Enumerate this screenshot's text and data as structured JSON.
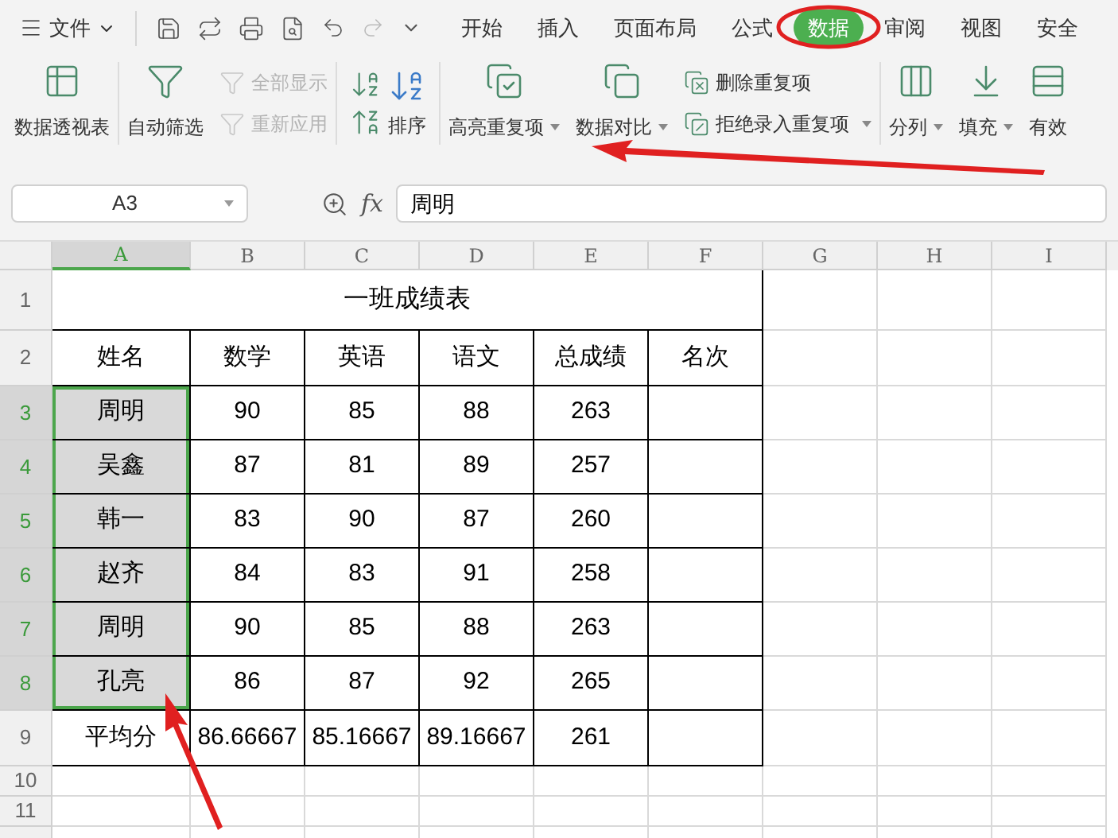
{
  "menu": {
    "file_label": "文件",
    "tabs": [
      {
        "label": "开始",
        "selected": false
      },
      {
        "label": "插入",
        "selected": false
      },
      {
        "label": "页面布局",
        "selected": false
      },
      {
        "label": "公式",
        "selected": false
      },
      {
        "label": "数据",
        "selected": true
      },
      {
        "label": "审阅",
        "selected": false
      },
      {
        "label": "视图",
        "selected": false
      },
      {
        "label": "安全",
        "selected": false
      }
    ]
  },
  "ribbon": [
    {
      "kind": "large",
      "label": "数据透视表",
      "disabled": false,
      "dropdown": false
    },
    {
      "kind": "large",
      "label": "自动筛选",
      "disabled": false,
      "dropdown": false
    },
    {
      "kind": "stack",
      "items": [
        {
          "label": "全部显示",
          "disabled": true,
          "dropdown": false
        },
        {
          "label": "重新应用",
          "disabled": true,
          "dropdown": false
        }
      ]
    },
    {
      "kind": "sort",
      "label": "排序",
      "disabled": false,
      "dropdown": false
    },
    {
      "kind": "large",
      "label": "高亮重复项",
      "disabled": false,
      "dropdown": true
    },
    {
      "kind": "large",
      "label": "数据对比",
      "disabled": false,
      "dropdown": true
    },
    {
      "kind": "stack",
      "items": [
        {
          "label": "删除重复项",
          "disabled": false,
          "dropdown": false
        },
        {
          "label": "拒绝录入重复项",
          "disabled": false,
          "dropdown": true
        }
      ]
    },
    {
      "kind": "large",
      "label": "分列",
      "disabled": false,
      "dropdown": true
    },
    {
      "kind": "large",
      "label": "填充",
      "disabled": false,
      "dropdown": true
    },
    {
      "kind": "large",
      "label": "有效",
      "disabled": false,
      "dropdown": false
    }
  ],
  "formula_bar": {
    "cell_ref": "A3",
    "fx": "fx",
    "value": "周明"
  },
  "sheet": {
    "columns": [
      {
        "label": "A",
        "selected": true
      },
      {
        "label": "B",
        "selected": false
      },
      {
        "label": "C",
        "selected": false
      },
      {
        "label": "D",
        "selected": false
      },
      {
        "label": "E",
        "selected": false
      },
      {
        "label": "F",
        "selected": false
      },
      {
        "label": "G",
        "selected": false
      },
      {
        "label": "H",
        "selected": false
      },
      {
        "label": "I",
        "selected": false
      }
    ],
    "rows": [
      {
        "kind": "title",
        "header": "1",
        "selected": false,
        "title": "一班成绩表"
      },
      {
        "kind": "data",
        "header": "2",
        "selected": false,
        "cells": [
          {
            "text": "姓名",
            "selected": false
          },
          {
            "text": "数学",
            "selected": false
          },
          {
            "text": "英语",
            "selected": false
          },
          {
            "text": "语文",
            "selected": false
          },
          {
            "text": "总成绩",
            "selected": false
          },
          {
            "text": "名次",
            "selected": false
          }
        ]
      },
      {
        "kind": "data",
        "header": "3",
        "selected": true,
        "cells": [
          {
            "text": "周明",
            "selected": true
          },
          {
            "text": "90",
            "selected": false
          },
          {
            "text": "85",
            "selected": false
          },
          {
            "text": "88",
            "selected": false
          },
          {
            "text": "263",
            "selected": false
          },
          {
            "selected": false
          }
        ]
      },
      {
        "kind": "data",
        "header": "4",
        "selected": true,
        "cells": [
          {
            "text": "吴鑫",
            "selected": true
          },
          {
            "text": "87",
            "selected": false
          },
          {
            "text": "81",
            "selected": false
          },
          {
            "text": "89",
            "selected": false
          },
          {
            "text": "257",
            "selected": false
          },
          {
            "selected": false
          }
        ]
      },
      {
        "kind": "data",
        "header": "5",
        "selected": true,
        "cells": [
          {
            "text": "韩一",
            "selected": true
          },
          {
            "text": "83",
            "selected": false
          },
          {
            "text": "90",
            "selected": false
          },
          {
            "text": "87",
            "selected": false
          },
          {
            "text": "260",
            "selected": false
          },
          {
            "selected": false
          }
        ]
      },
      {
        "kind": "data",
        "header": "6",
        "selected": true,
        "cells": [
          {
            "text": "赵齐",
            "selected": true
          },
          {
            "text": "84",
            "selected": false
          },
          {
            "text": "83",
            "selected": false
          },
          {
            "text": "91",
            "selected": false
          },
          {
            "text": "258",
            "selected": false
          },
          {
            "selected": false
          }
        ]
      },
      {
        "kind": "data",
        "header": "7",
        "selected": true,
        "cells": [
          {
            "text": "周明",
            "selected": true
          },
          {
            "text": "90",
            "selected": false
          },
          {
            "text": "85",
            "selected": false
          },
          {
            "text": "88",
            "selected": false
          },
          {
            "text": "263",
            "selected": false
          },
          {
            "selected": false
          }
        ]
      },
      {
        "kind": "data",
        "header": "8",
        "selected": true,
        "cells": [
          {
            "text": "孔亮",
            "selected": true
          },
          {
            "text": "86",
            "selected": false
          },
          {
            "text": "87",
            "selected": false
          },
          {
            "text": "92",
            "selected": false
          },
          {
            "text": "265",
            "selected": false
          },
          {
            "selected": false
          }
        ]
      },
      {
        "kind": "data",
        "header": "9",
        "selected": false,
        "cells": [
          {
            "text": "平均分",
            "selected": false
          },
          {
            "text": "86.66667",
            "selected": false
          },
          {
            "text": "85.16667",
            "selected": false
          },
          {
            "text": "89.16667",
            "selected": false
          },
          {
            "text": "261",
            "selected": false
          },
          {
            "selected": false
          }
        ]
      },
      {
        "kind": "empty",
        "header": "10",
        "selected": false
      },
      {
        "kind": "empty",
        "header": "11",
        "selected": false
      }
    ]
  }
}
